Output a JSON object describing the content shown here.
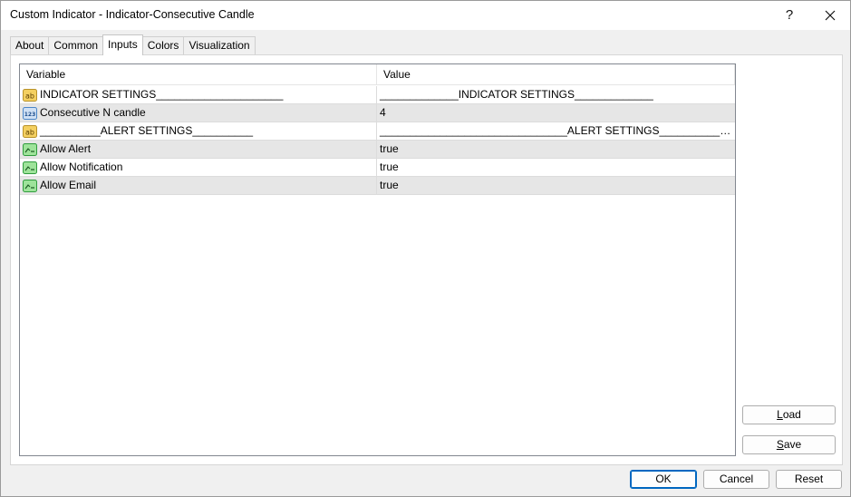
{
  "window": {
    "title": "Custom Indicator - Indicator-Consecutive Candle",
    "help_glyph": "?",
    "close_glyph": "close-icon"
  },
  "tabs": [
    {
      "label": "About",
      "active": false
    },
    {
      "label": "Common",
      "active": false
    },
    {
      "label": "Inputs",
      "active": true
    },
    {
      "label": "Colors",
      "active": false
    },
    {
      "label": "Visualization",
      "active": false
    }
  ],
  "grid": {
    "columns": {
      "variable": "Variable",
      "value": "Value"
    },
    "rows": [
      {
        "icon": "string-ab-icon",
        "variable": "INDICATOR SETTINGS_____________________",
        "value": "_____________INDICATOR SETTINGS_____________"
      },
      {
        "icon": "integer-123-icon",
        "variable": "Consecutive N candle",
        "value": "4"
      },
      {
        "icon": "string-ab-icon",
        "variable": "__________ALERT SETTINGS__________",
        "value": "_______________________________ALERT SETTINGS________________..."
      },
      {
        "icon": "boolean-toggle-icon",
        "variable": "Allow Alert",
        "value": "true"
      },
      {
        "icon": "boolean-toggle-icon",
        "variable": "Allow Notification",
        "value": "true"
      },
      {
        "icon": "boolean-toggle-icon",
        "variable": "Allow Email",
        "value": "true"
      }
    ]
  },
  "side_buttons": {
    "load": {
      "first": "L",
      "rest": "oad"
    },
    "save": {
      "first": "S",
      "rest": "ave"
    }
  },
  "footer_buttons": {
    "ok": "OK",
    "cancel": "Cancel",
    "reset": "Reset"
  },
  "colors": {
    "accent": "#0067c0",
    "alt_row": "#e6e6e6",
    "string_icon": "#e8c44a",
    "integer_icon": "#4a86c8",
    "boolean_icon": "#3bb54a"
  }
}
